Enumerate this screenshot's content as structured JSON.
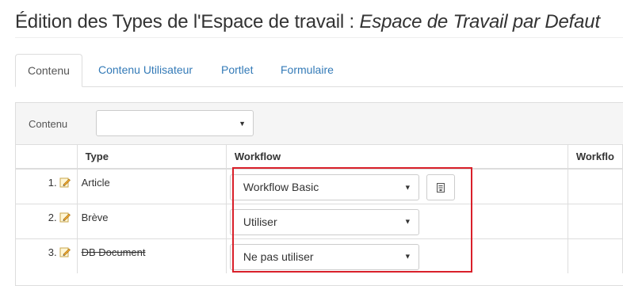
{
  "page": {
    "title_prefix": "Édition des Types de l'Espace de travail : ",
    "title_workspace": "Espace de Travail par Defaut"
  },
  "tabs": [
    "Contenu",
    "Contenu Utilisateur",
    "Portlet",
    "Formulaire"
  ],
  "active_tab": "Contenu",
  "filter": {
    "label": "Contenu",
    "value": ""
  },
  "table": {
    "headers": {
      "type": "Type",
      "workflow": "Workflow",
      "workflow_extra": "Workflo"
    },
    "rows": [
      {
        "num": "1.",
        "type": "Article",
        "workflow": "Workflow Basic",
        "has_button": true,
        "strikethrough": false
      },
      {
        "num": "2.",
        "type": "Brève",
        "workflow": "Utiliser",
        "has_button": false,
        "strikethrough": false
      },
      {
        "num": "3.",
        "type": "DB Document",
        "workflow": "Ne pas utiliser",
        "has_button": false,
        "strikethrough": true
      }
    ]
  },
  "icons": {
    "edit": "pencil-icon",
    "dropdown": "caret-down-icon",
    "action": "document-icon"
  },
  "colors": {
    "link": "#337ab7",
    "highlight": "#d9202a",
    "border": "#dddddd",
    "bar": "#f5f5f5"
  }
}
